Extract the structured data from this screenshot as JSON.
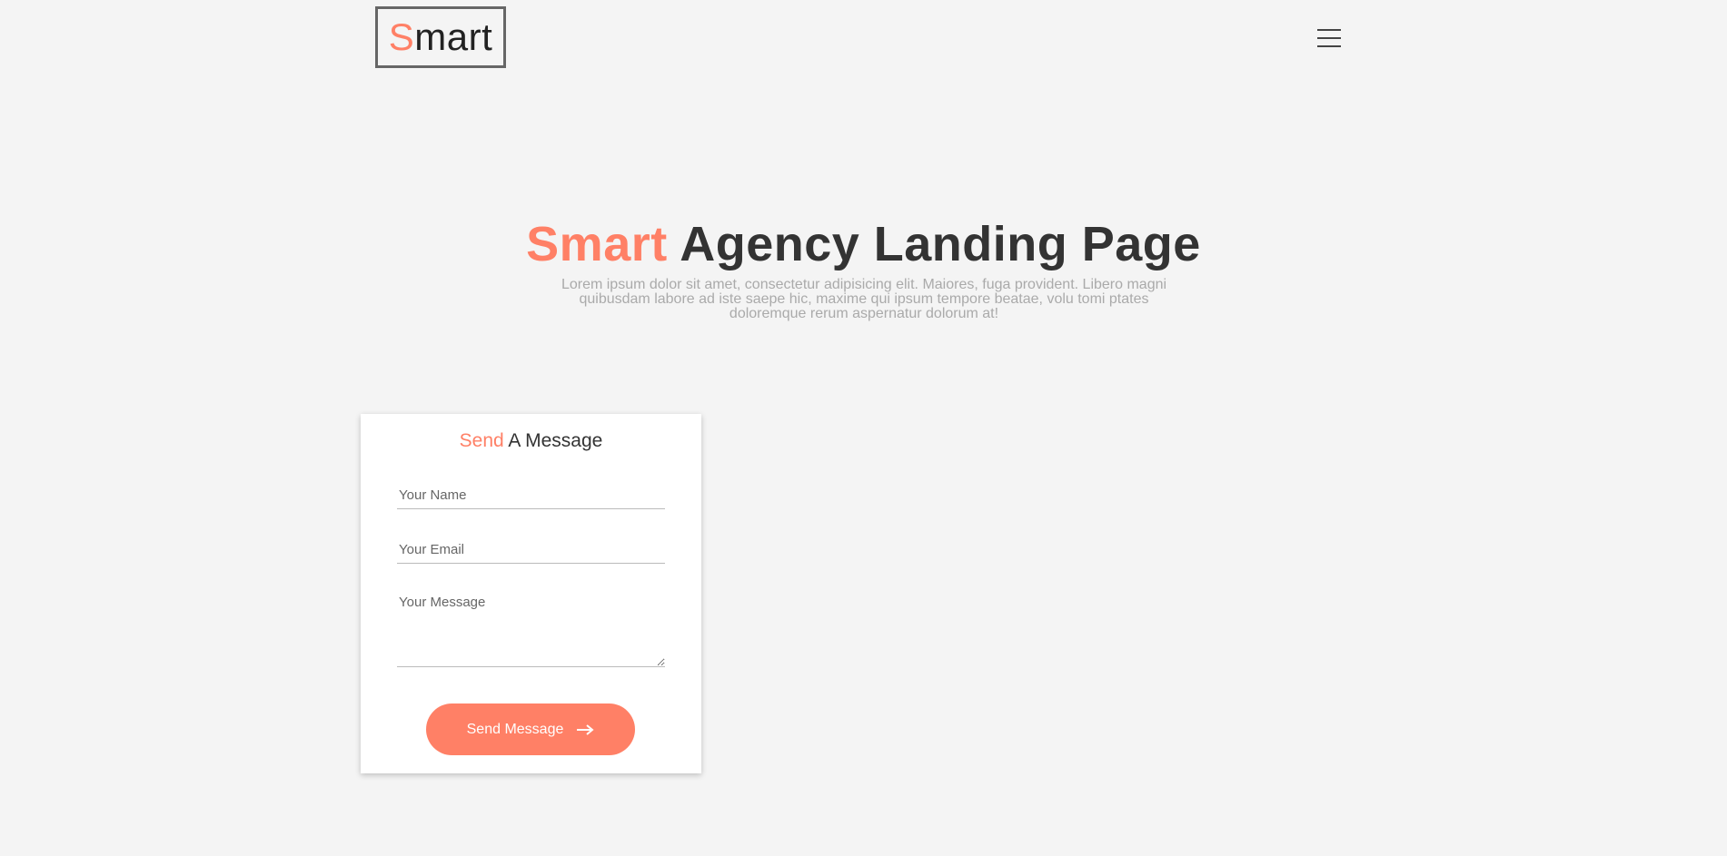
{
  "header": {
    "logo": {
      "accent": "S",
      "rest": "mart"
    },
    "menu_icon": "hamburger-icon"
  },
  "hero": {
    "title_accent": "Smart",
    "title_rest": "Agency Landing Page",
    "description": "Lorem ipsum dolor sit amet, consectetur adipisicing elit. Maiores, fuga provident. Libero magni quibusdam labore ad iste saepe hic, maxime qui ipsum tempore beatae, volu tomi ptates doloremque rerum aspernatur dolorum at!"
  },
  "contact_form": {
    "title_accent": "Send",
    "title_rest": "A Message",
    "name_placeholder": "Your Name",
    "email_placeholder": "Your Email",
    "message_placeholder": "Your Message",
    "submit_label": "Send Message",
    "submit_icon": "arrow-right-icon"
  },
  "colors": {
    "accent": "#ff8066",
    "background": "#f4f4f4",
    "text_dark": "#333333",
    "text_muted": "#aaaaaa"
  }
}
